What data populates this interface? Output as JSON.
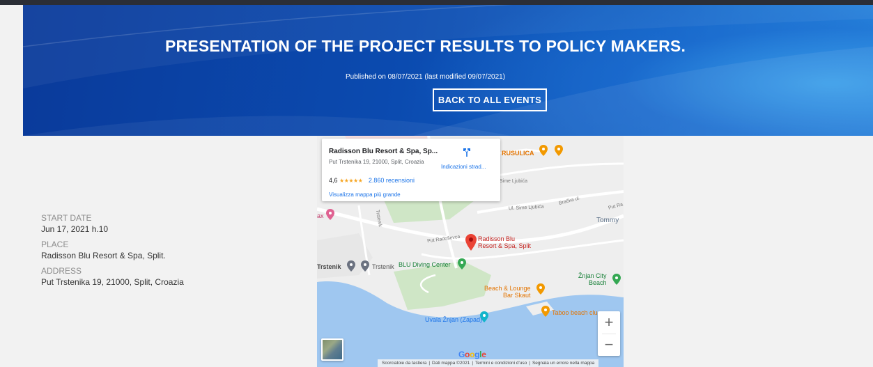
{
  "hero": {
    "title": "PRESENTATION OF THE PROJECT RESULTS TO POLICY MAKERS.",
    "published": "Published on 08/07/2021 (last modified 09/07/2021)",
    "back_label": "BACK TO ALL EVENTS"
  },
  "info": {
    "start_label": "START DATE",
    "start_value": "Jun 17, 2021 h.10",
    "place_label": "PLACE",
    "place_value": "Radisson Blu Resort & Spa, Split.",
    "address_label": "ADDRESS",
    "address_value": "Put Trstenika 19, 21000, Split, Croazia"
  },
  "map": {
    "card": {
      "name": "Radisson Blu Resort & Spa, Sp...",
      "address": "Put Trstenika 19, 21000, Split, Croazia",
      "rating": "4,6",
      "stars": "★★★★★",
      "reviews": "2.860 recensioni",
      "directions": "Indicazioni strad...",
      "bigger_map": "Visualizza mappa più grande"
    },
    "pin_label_1": "Radisson Blu",
    "pin_label_2": "Resort & Spa, Split",
    "places": {
      "rusulica": "RUSULICA",
      "trstenik1": "Trstenik",
      "trstenik2": "Trstenik",
      "blu_diving": "BLU Diving Center",
      "znjan_beach": "Žnjan City\nBeach",
      "beach_lounge": "Beach & Lounge\nBar Skaut",
      "taboo": "Taboo beach club Split",
      "uvala": "Uvala Žnjan (Zapad)",
      "tommy": "Tommy",
      "ax": "ax",
      "put_radosevca": "Put Radoševca",
      "sime_ljubica1": "Ul. Sime Ljubića",
      "sime_ljubica2": "Sime Ljubića",
      "bracka": "Bračka ul.",
      "put_ra": "Put Ra",
      "trstenik_rd": "Trstenik"
    },
    "zoom_in": "+",
    "zoom_out": "−",
    "google": [
      "G",
      "o",
      "o",
      "g",
      "l",
      "e"
    ],
    "attribution": {
      "shortcuts": "Scorciatoie da tastiera",
      "data": "Dati mappa ©2021",
      "terms": "Termini e condizioni d'uso",
      "report": "Segnala un errore nella mappa"
    }
  },
  "colors": {
    "pin": "#ea4335",
    "water": "#9fc7f0",
    "park": "#cfe6c6"
  }
}
